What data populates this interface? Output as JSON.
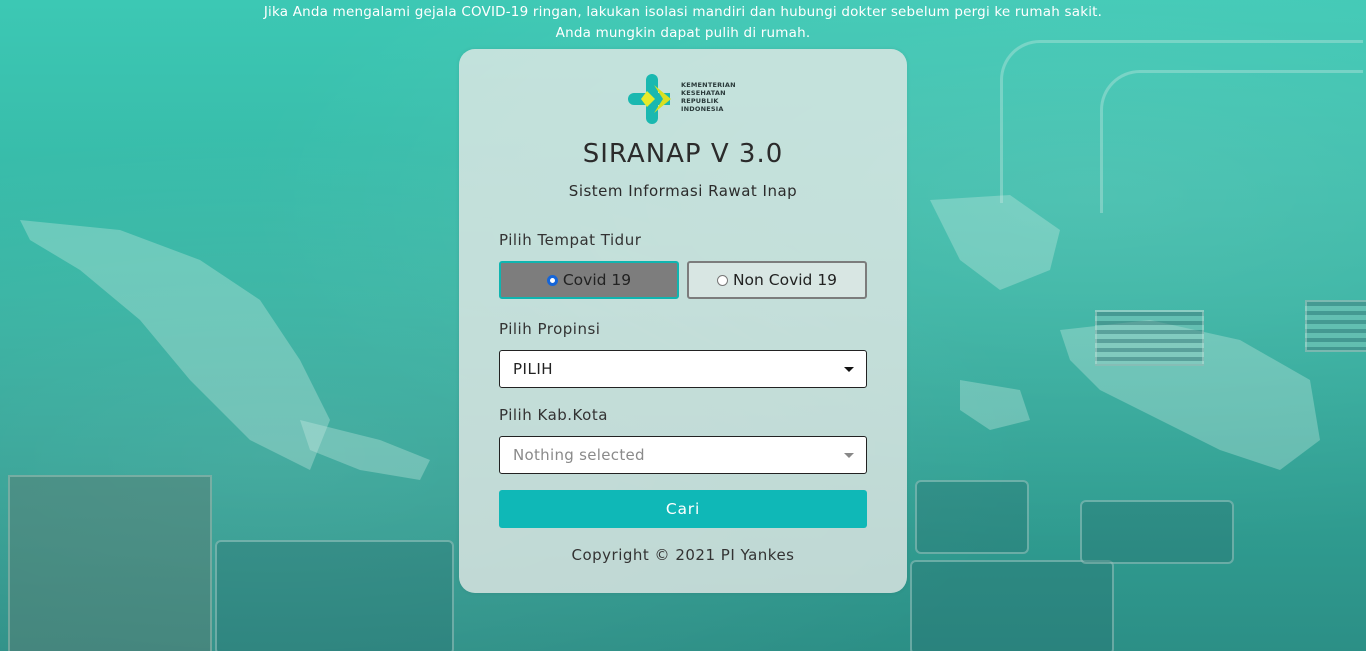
{
  "notice": {
    "line1": "Jika Anda mengalami gejala COVID-19 ringan, lakukan isolasi mandiri dan hubungi dokter sebelum pergi ke rumah sakit.",
    "line2": "Anda mungkin dapat pulih di rumah."
  },
  "logo": {
    "line1": "KEMENTERIAN",
    "line2": "KESEHATAN",
    "line3": "REPUBLIK",
    "line4": "INDONESIA"
  },
  "title": "SIRANAP V 3.0",
  "subtitle": "Sistem Informasi Rawat Inap",
  "bed_type": {
    "label": "Pilih Tempat Tidur",
    "options": [
      {
        "label": "Covid 19",
        "selected": true
      },
      {
        "label": "Non Covid 19",
        "selected": false
      }
    ]
  },
  "province": {
    "label": "Pilih Propinsi",
    "value": "PILIH"
  },
  "city": {
    "label": "Pilih Kab.Kota",
    "placeholder": "Nothing selected"
  },
  "search_button": "Cari",
  "copyright": "Copyright © 2021 PI Yankes",
  "colors": {
    "accent": "#0fb8b7",
    "background": "#3cc8b4",
    "radio_checked": "#1565d8"
  },
  "icons": {
    "logo": "kemenkes-logo-icon",
    "caret": "caret-down-icon"
  }
}
